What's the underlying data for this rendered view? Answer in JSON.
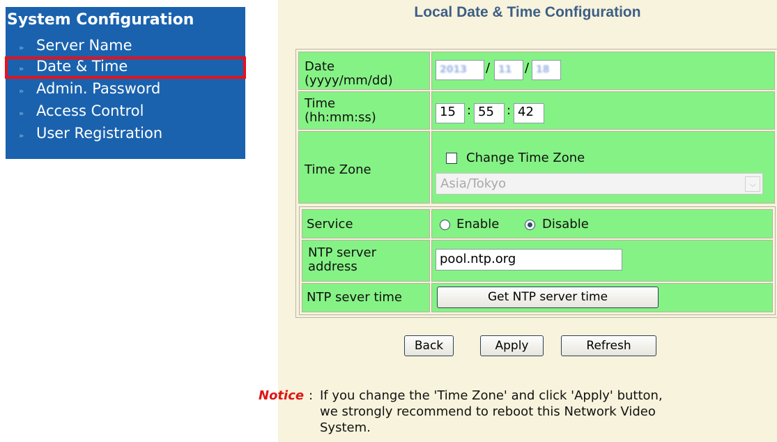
{
  "sidebar": {
    "title": "System Configuration",
    "items": [
      {
        "label": "Server Name"
      },
      {
        "label": "Date & Time"
      },
      {
        "label": "Admin. Password"
      },
      {
        "label": "Access Control"
      },
      {
        "label": "User Registration"
      }
    ],
    "selected_index": 1
  },
  "page": {
    "title": "Local Date & Time Configuration"
  },
  "form": {
    "date": {
      "label_line1": "Date",
      "label_line2": "(yyyy/mm/dd)",
      "year": "2013",
      "month": "11",
      "day": "18",
      "sep": "/"
    },
    "time": {
      "label_line1": "Time",
      "label_line2": "(hh:mm:ss)",
      "hour": "15",
      "minute": "55",
      "second": "42",
      "sep": ":"
    },
    "timezone": {
      "label": "Time Zone",
      "checkbox_label": "Change Time Zone",
      "checked": false,
      "selected": "Asia/Tokyo"
    },
    "service": {
      "label": "Service",
      "enable_label": "Enable",
      "disable_label": "Disable",
      "selected": "Disable"
    },
    "ntp_address": {
      "label_line1": "NTP server",
      "label_line2": "address",
      "value": "pool.ntp.org"
    },
    "ntp_time": {
      "label": "NTP sever time",
      "button_label": "Get NTP server time"
    }
  },
  "buttons": {
    "back": "Back",
    "apply": "Apply",
    "refresh": "Refresh"
  },
  "notice": {
    "word": "Notice",
    "colon": ":",
    "line1": "If you change the 'Time Zone' and click 'Apply' button,",
    "line2": "we strongly recommend to reboot this Network Video",
    "line3": "System."
  },
  "colors": {
    "sidebar_bg": "#1a62ae",
    "panel_bg": "#f7f3dc",
    "cell_green": "#85f285",
    "highlight_red": "#e8111b",
    "notice_red": "#e01515"
  }
}
